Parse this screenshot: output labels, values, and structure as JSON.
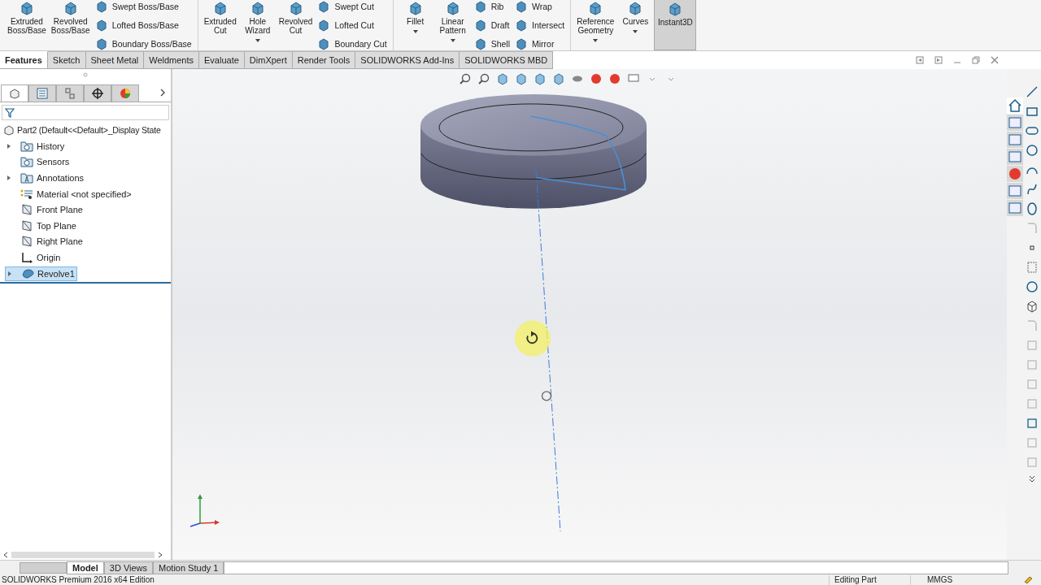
{
  "ribbon": {
    "groups": [
      {
        "columns": [
          {
            "kind": "large",
            "lines": [
              "Extruded",
              "Boss/Base"
            ],
            "dropdown": false,
            "selected": false
          },
          {
            "kind": "large",
            "lines": [
              "Revolved",
              "Boss/Base"
            ],
            "dropdown": false,
            "selected": false
          },
          {
            "kind": "stack",
            "items": [
              "Swept Boss/Base",
              "Lofted Boss/Base",
              "Boundary Boss/Base"
            ]
          }
        ]
      },
      {
        "columns": [
          {
            "kind": "large",
            "lines": [
              "Extruded",
              "Cut"
            ],
            "dropdown": false,
            "selected": false
          },
          {
            "kind": "large",
            "lines": [
              "Hole",
              "Wizard"
            ],
            "dropdown": true,
            "selected": false
          },
          {
            "kind": "large",
            "lines": [
              "Revolved",
              "Cut"
            ],
            "dropdown": false,
            "selected": false
          },
          {
            "kind": "stack",
            "items": [
              "Swept Cut",
              "Lofted Cut",
              "Boundary Cut"
            ]
          }
        ]
      },
      {
        "columns": [
          {
            "kind": "large",
            "lines": [
              "Fillet"
            ],
            "dropdown": true,
            "selected": false
          },
          {
            "kind": "large",
            "lines": [
              "Linear",
              "Pattern"
            ],
            "dropdown": true,
            "selected": false
          },
          {
            "kind": "stack",
            "items": [
              "Rib",
              "Draft",
              "Shell"
            ]
          },
          {
            "kind": "stack",
            "items": [
              "Wrap",
              "Intersect",
              "Mirror"
            ]
          }
        ]
      },
      {
        "columns": [
          {
            "kind": "large",
            "lines": [
              "Reference",
              "Geometry"
            ],
            "dropdown": true,
            "selected": false
          },
          {
            "kind": "large",
            "lines": [
              "Curves"
            ],
            "dropdown": true,
            "selected": false
          },
          {
            "kind": "large",
            "lines": [
              "Instant3D"
            ],
            "dropdown": false,
            "selected": true
          }
        ]
      }
    ]
  },
  "command_tabs": [
    {
      "label": "Features",
      "selected": true
    },
    {
      "label": "Sketch",
      "selected": false
    },
    {
      "label": "Sheet Metal",
      "selected": false
    },
    {
      "label": "Weldments",
      "selected": false
    },
    {
      "label": "Evaluate",
      "selected": false
    },
    {
      "label": "DimXpert",
      "selected": false
    },
    {
      "label": "Render Tools",
      "selected": false
    },
    {
      "label": "SOLIDWORKS Add-Ins",
      "selected": false
    },
    {
      "label": "SOLIDWORKS MBD",
      "selected": false
    }
  ],
  "feature_tree": {
    "panel_tabs": [
      {
        "selected": true
      },
      {
        "selected": false
      },
      {
        "selected": false
      },
      {
        "selected": false
      },
      {
        "selected": false
      }
    ],
    "root": "Part2  (Default<<Default>_Display State",
    "items": [
      {
        "label": "History",
        "kind": "folder",
        "expandable": true,
        "selected": false
      },
      {
        "label": "Sensors",
        "kind": "folder",
        "expandable": false,
        "selected": false
      },
      {
        "label": "Annotations",
        "kind": "annotations",
        "expandable": true,
        "selected": false
      },
      {
        "label": "Material <not specified>",
        "kind": "material",
        "expandable": false,
        "selected": false
      },
      {
        "label": "Front Plane",
        "kind": "plane",
        "expandable": false,
        "selected": false
      },
      {
        "label": "Top Plane",
        "kind": "plane",
        "expandable": false,
        "selected": false
      },
      {
        "label": "Right Plane",
        "kind": "plane",
        "expandable": false,
        "selected": false
      },
      {
        "label": "Origin",
        "kind": "origin",
        "expandable": false,
        "selected": false
      },
      {
        "label": "Revolve1",
        "kind": "feature",
        "expandable": true,
        "selected": true
      }
    ]
  },
  "bottom_tabs": [
    {
      "label": "Model",
      "selected": true
    },
    {
      "label": "3D Views",
      "selected": false
    },
    {
      "label": "Motion Study 1",
      "selected": false
    }
  ],
  "status_bar": {
    "edition": "SOLIDWORKS Premium 2016 x64 Edition",
    "mode": "Editing Part",
    "units": "MMGS"
  }
}
